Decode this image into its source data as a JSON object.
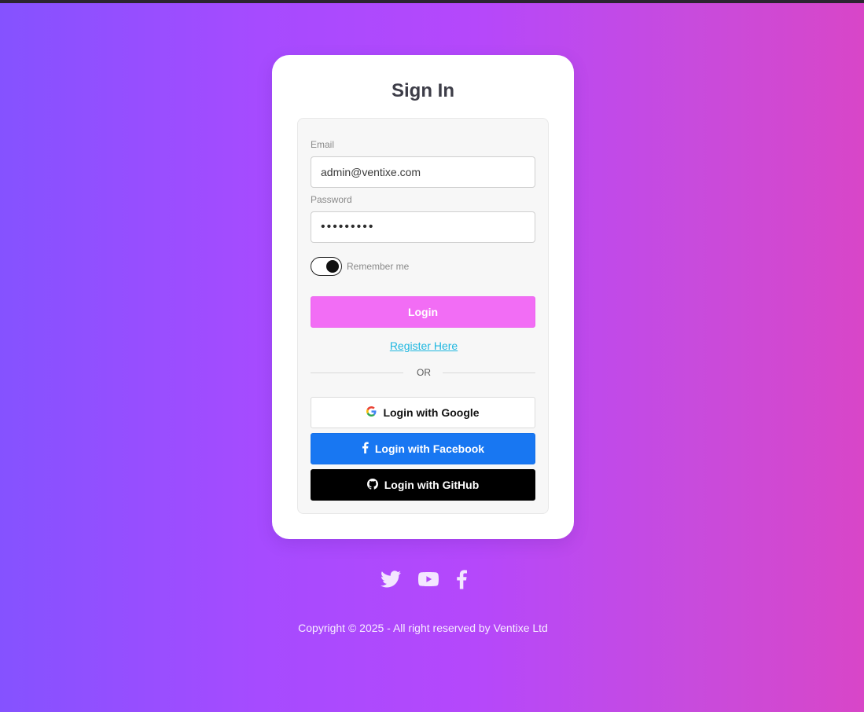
{
  "page": {
    "title": "Sign In"
  },
  "form": {
    "email_label": "Email",
    "email_value": "admin@ventixe.com",
    "password_label": "Password",
    "password_value": "•••••••••",
    "remember_label": "Remember me",
    "remember_checked": true,
    "login_label": "Login",
    "register_label": "Register Here",
    "divider_label": "OR"
  },
  "social_login": {
    "google_label": "Login with Google",
    "facebook_label": "Login with Facebook",
    "github_label": "Login with GitHub"
  },
  "footer": {
    "social_icons": [
      "twitter-icon",
      "youtube-icon",
      "facebook-icon"
    ],
    "copyright": "Copyright © 2025 - All right reserved by Ventixe Ltd"
  },
  "colors": {
    "login_button": "#f26df5",
    "facebook_button": "#1877f2",
    "github_button": "#000000",
    "register_link": "#1fb7e0",
    "background_start": "#8552ff",
    "background_end": "#d846c8"
  }
}
